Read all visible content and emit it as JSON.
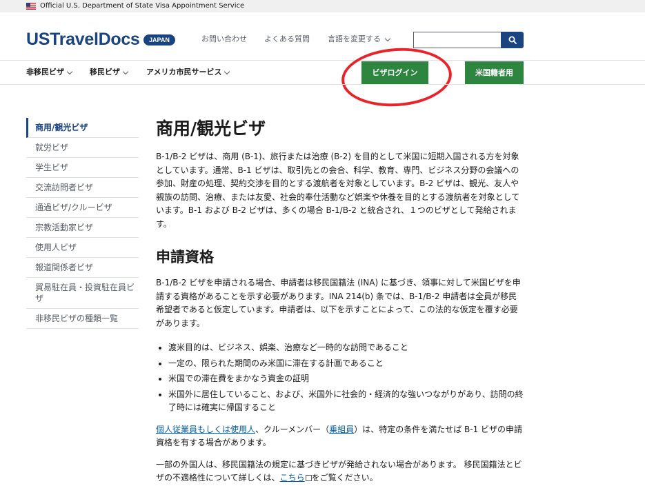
{
  "gov_banner": {
    "text": "Official U.S. Department of State Visa Appointment Service"
  },
  "header": {
    "logo": "USTravelDocs",
    "badge": "JAPAN",
    "links": {
      "contact": "お問い合わせ",
      "faq": "よくある質問",
      "language": "言語を変更する"
    },
    "search": {
      "value": "",
      "placeholder": ""
    }
  },
  "nav": {
    "items": [
      {
        "label": "非移民ビザ"
      },
      {
        "label": "移民ビザ"
      },
      {
        "label": "アメリカ市民サービス"
      }
    ],
    "visa_login": "ビザログイン",
    "us_citizen": "米国籍者用"
  },
  "sidebar": {
    "items": [
      {
        "label": "商用/観光ビザ"
      },
      {
        "label": "就労ビザ"
      },
      {
        "label": "学生ビザ"
      },
      {
        "label": "交流訪問者ビザ"
      },
      {
        "label": "通過ビザ/クルービザ"
      },
      {
        "label": "宗教活動家ビザ"
      },
      {
        "label": "使用人ビザ"
      },
      {
        "label": "報道関係者ビザ"
      },
      {
        "label": "貿易駐在員・投資駐在員ビザ"
      },
      {
        "label": "非移民ビザの種類一覧"
      }
    ]
  },
  "main": {
    "title": "商用/観光ビザ",
    "intro": "B-1/B-2 ビザは、商用 (B-1)、旅行または治療 (B-2) を目的として米国に短期入国される方を対象としています。通常、B-1 ビザは、取引先との会合、科学、教育、専門、ビジネス分野の会議への参加、財産の処理、契約交渉を目的とする渡航者を対象としています。B-2 ビザは、観光、友人や親族の訪問、治療、または友愛、社会的奉仕活動など娯楽や休養を目的とする渡航者を対象としています。B-1 および B-2 ビザは、多くの場合 B-1/B-2 と統合され、１つのビザとして発給されます。",
    "eligibility_heading": "申請資格",
    "eligibility_text": "B-1/B-2 ビザを申請される場合、申請者は移民国籍法 (INA) に基づき、領事に対して米国ビザを申請する資格があることを示す必要があります。INA 214(b) 条では、B-1/B-2 申請者は全員が移民希望者であると仮定しています。申請者は、以下を示すことによって、この法的な仮定を覆す必要があります。",
    "bullets": [
      "渡米目的は、ビジネス、娯楽、治療など一時的な訪問であること",
      "一定の、限られた期間のみ米国に滞在する計画であること",
      "米国での滞在費をまかなう資金の証明",
      "米国外に居住していること、および、米国外に社会的・経済的な強いつながりがあり、訪問の終了時には確実に帰国すること"
    ],
    "para3": {
      "link1": "個人従業員もしくは使用人",
      "text1": "、クルーメンバー（",
      "link2": "乗組員",
      "text2": "）は、特定の条件を満たせば B-1 ビザの申請資格を有する場合があります。"
    },
    "para4": {
      "text1": "一部の外国人は、移民国籍法の規定に基づきビザが発給されない場合があります。 移民国籍法とビザの不適格性について詳しくは、",
      "link": "こちら",
      "text2": "をご覧ください。"
    }
  },
  "colors": {
    "brand_blue": "#1a4480",
    "green": "#2e8540",
    "annotation_red": "#e8232a",
    "link": "#005ea2"
  }
}
